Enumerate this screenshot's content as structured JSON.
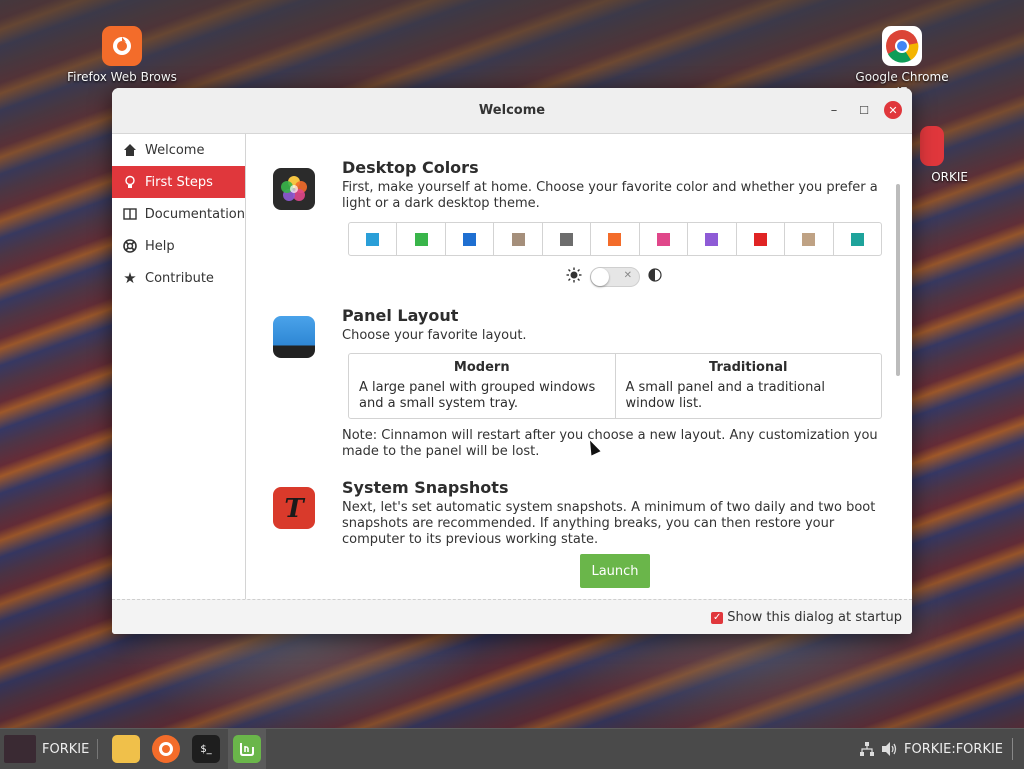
{
  "desktop": {
    "icons": [
      {
        "label": "Firefox Web Brows",
        "icon": "firefox-icon"
      },
      {
        "label": "Google Chrome",
        "sub": "IE",
        "icon": "chrome-icon"
      },
      {
        "label": "ORKIE",
        "icon": "app-icon"
      }
    ]
  },
  "window": {
    "title": "Welcome",
    "buttons": {
      "minimize": "–",
      "maximize": "☐",
      "close": "✕"
    }
  },
  "sidebar": {
    "items": [
      {
        "label": "Welcome",
        "icon": "home-icon",
        "active": false
      },
      {
        "label": "First Steps",
        "icon": "lightbulb-icon",
        "active": true
      },
      {
        "label": "Documentation",
        "icon": "book-icon",
        "active": false
      },
      {
        "label": "Help",
        "icon": "lifebuoy-icon",
        "active": false
      },
      {
        "label": "Contribute",
        "icon": "star-icon",
        "active": false
      }
    ]
  },
  "desktop_colors": {
    "title": "Desktop Colors",
    "text": "First, make yourself at home. Choose your favorite color and whether you prefer a light or a dark desktop theme.",
    "swatches": [
      "#2a9fd8",
      "#39b54a",
      "#1f6fd1",
      "#a58f7b",
      "#6d6d6d",
      "#f36c2a",
      "#e0478a",
      "#8e5bd6",
      "#e02424",
      "#bfa284",
      "#1ea39b"
    ],
    "dark_mode": false,
    "toggle_off_mark": "✕"
  },
  "panel_layout": {
    "title": "Panel Layout",
    "text": "Choose your favorite layout.",
    "options": [
      {
        "name": "Modern",
        "desc": "A large panel with grouped windows and a small system tray."
      },
      {
        "name": "Traditional",
        "desc": "A small panel and a traditional window list."
      }
    ],
    "note": "Note: Cinnamon will restart after you choose a new layout. Any customization you made to the panel will be lost."
  },
  "snapshots": {
    "title": "System Snapshots",
    "text": "Next, let's set automatic system snapshots. A minimum of two daily and two boot snapshots are recommended. If anything breaks, you can then restore your computer to its previous working state.",
    "button": "Launch"
  },
  "footer": {
    "startup_label": "Show this dialog at startup",
    "startup_checked": true
  },
  "taskbar": {
    "user_label": "FORKIE",
    "status_label": "FORKIE:FORKIE"
  }
}
